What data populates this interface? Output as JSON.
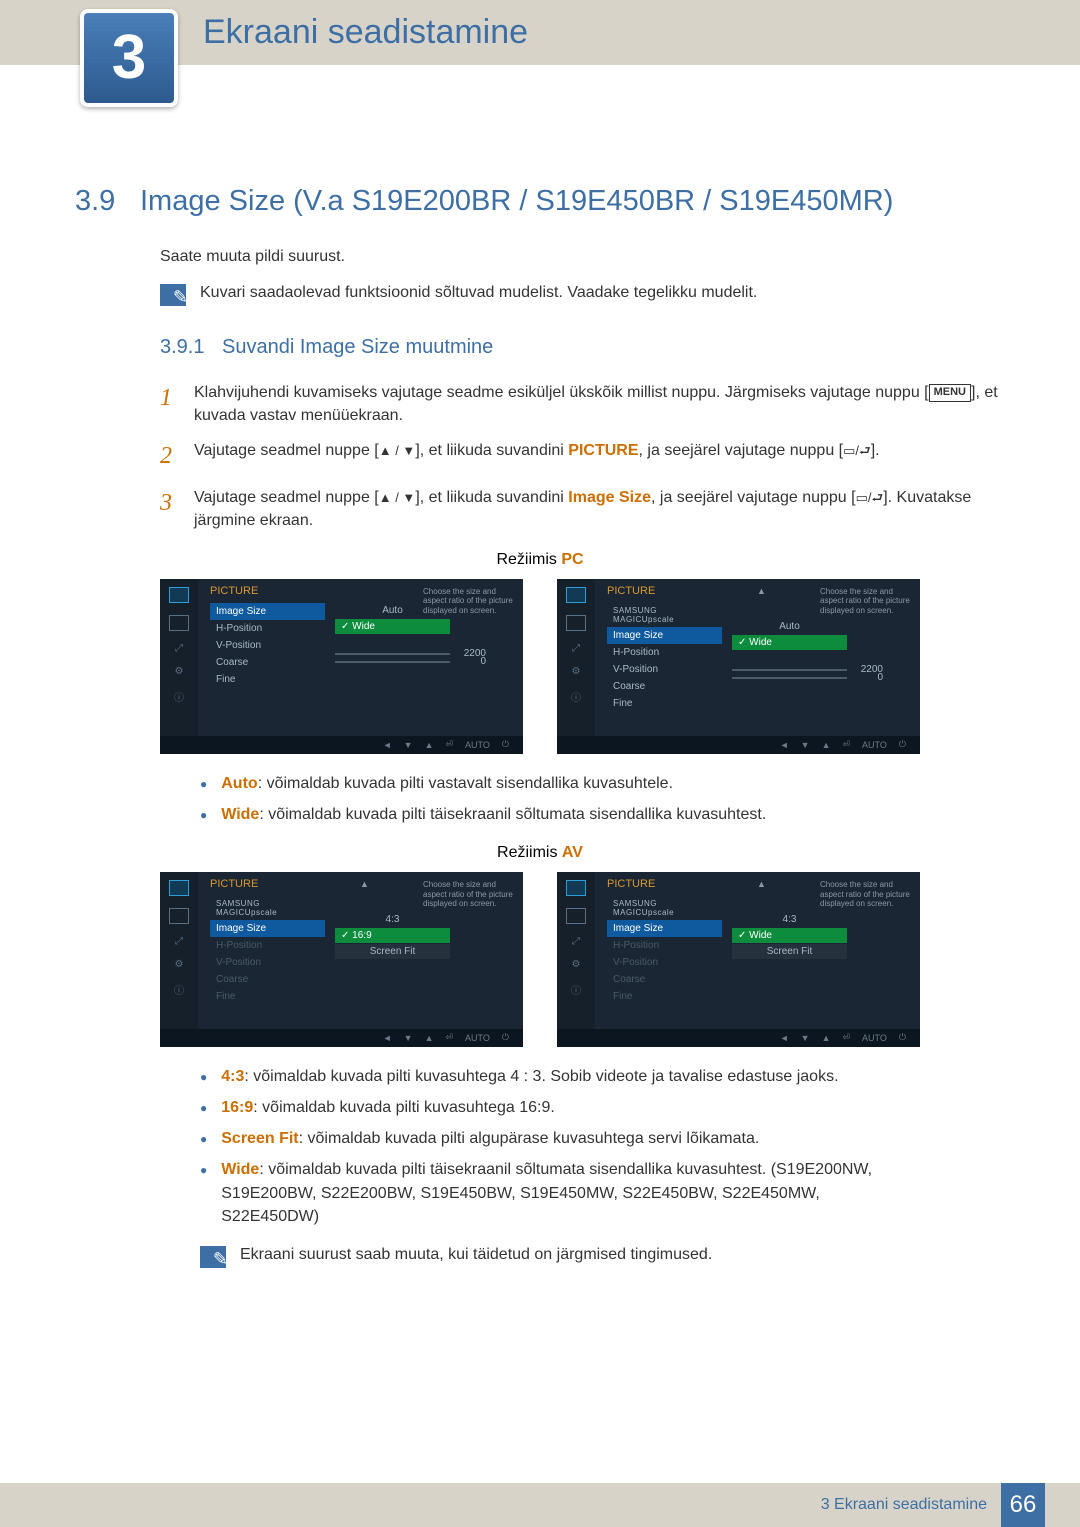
{
  "chapter": {
    "number": "3",
    "title": "Ekraani seadistamine"
  },
  "section": {
    "number": "3.9",
    "title": "Image Size (V.a S19E200BR / S19E450BR / S19E450MR)"
  },
  "intro": "Saate muuta pildi suurust.",
  "note1": "Kuvari saadaolevad funktsioonid sõltuvad mudelist. Vaadake tegelikku mudelit.",
  "subsection": {
    "number": "3.9.1",
    "title": "Suvandi Image Size muutmine"
  },
  "steps": [
    {
      "n": "1",
      "pre": "Klahvijuhendi kuvamiseks vajutage seadme esiküljel ükskõik millist nuppu. Järgmiseks vajutage nuppu [",
      "menu": "MENU",
      "post": "], et kuvada vastav menüüekraan."
    },
    {
      "n": "2",
      "pre": "Vajutage seadmel nuppe [",
      "icons1": "▲ / ▼",
      "mid": "], et liikuda suvandini ",
      "kw": "PICTURE",
      "mid2": ", ja seejärel vajutage nuppu [",
      "icons2": "▭/⮐",
      "post": "]."
    },
    {
      "n": "3",
      "pre": "Vajutage seadmel nuppe [",
      "icons1": "▲ / ▼",
      "mid": "], et liikuda suvandini ",
      "kw": "Image Size",
      "mid2": ", ja seejärel vajutage nuppu [",
      "icons2": "▭/⮐",
      "post": "]. Kuvatakse järgmine ekraan."
    }
  ],
  "mode_pc_label_prefix": "Režiimis ",
  "mode_pc_label": "PC",
  "mode_av_label": "AV",
  "osd_help": "Choose the size and aspect ratio of the picture displayed on screen.",
  "osd_title": "PICTURE",
  "osd_footer_auto": "AUTO",
  "osd_pc": {
    "items": [
      "Image Size",
      "H-Position",
      "V-Position",
      "Coarse",
      "Fine"
    ],
    "magic": "SAMSUNG MAGICUpscale",
    "vals": {
      "auto": "Auto",
      "wide": "Wide",
      "coarse": "2200",
      "fine": "0"
    }
  },
  "osd_av": {
    "items": [
      "Image Size",
      "H-Position",
      "V-Position",
      "Coarse",
      "Fine"
    ],
    "vals": {
      "r43": "4:3",
      "r169": "16:9",
      "fit": "Screen Fit",
      "wide": "Wide"
    }
  },
  "bullets_pc": [
    {
      "kw": "Auto",
      "text": ": võimaldab kuvada pilti vastavalt sisendallika kuvasuhtele."
    },
    {
      "kw": "Wide",
      "text": ": võimaldab kuvada pilti täisekraanil sõltumata sisendallika kuvasuhtest."
    }
  ],
  "bullets_av": [
    {
      "kw": "4:3",
      "text": ": võimaldab kuvada pilti kuvasuhtega 4 : 3. Sobib videote ja tavalise edastuse jaoks."
    },
    {
      "kw": "16:9",
      "text": ": võimaldab kuvada pilti kuvasuhtega 16:9."
    },
    {
      "kw": "Screen Fit",
      "text": ": võimaldab kuvada pilti algupärase kuvasuhtega servi lõikamata."
    },
    {
      "kw": "Wide",
      "text": ": võimaldab kuvada pilti täisekraanil sõltumata sisendallika kuvasuhtest. (S19E200NW, S19E200BW, S22E200BW, S19E450BW, S19E450MW, S22E450BW, S22E450MW, S22E450DW)"
    }
  ],
  "note2": "Ekraani suurust saab muuta, kui täidetud on järgmised tingimused.",
  "footer": {
    "chapter": "3 Ekraani seadistamine",
    "page": "66"
  }
}
